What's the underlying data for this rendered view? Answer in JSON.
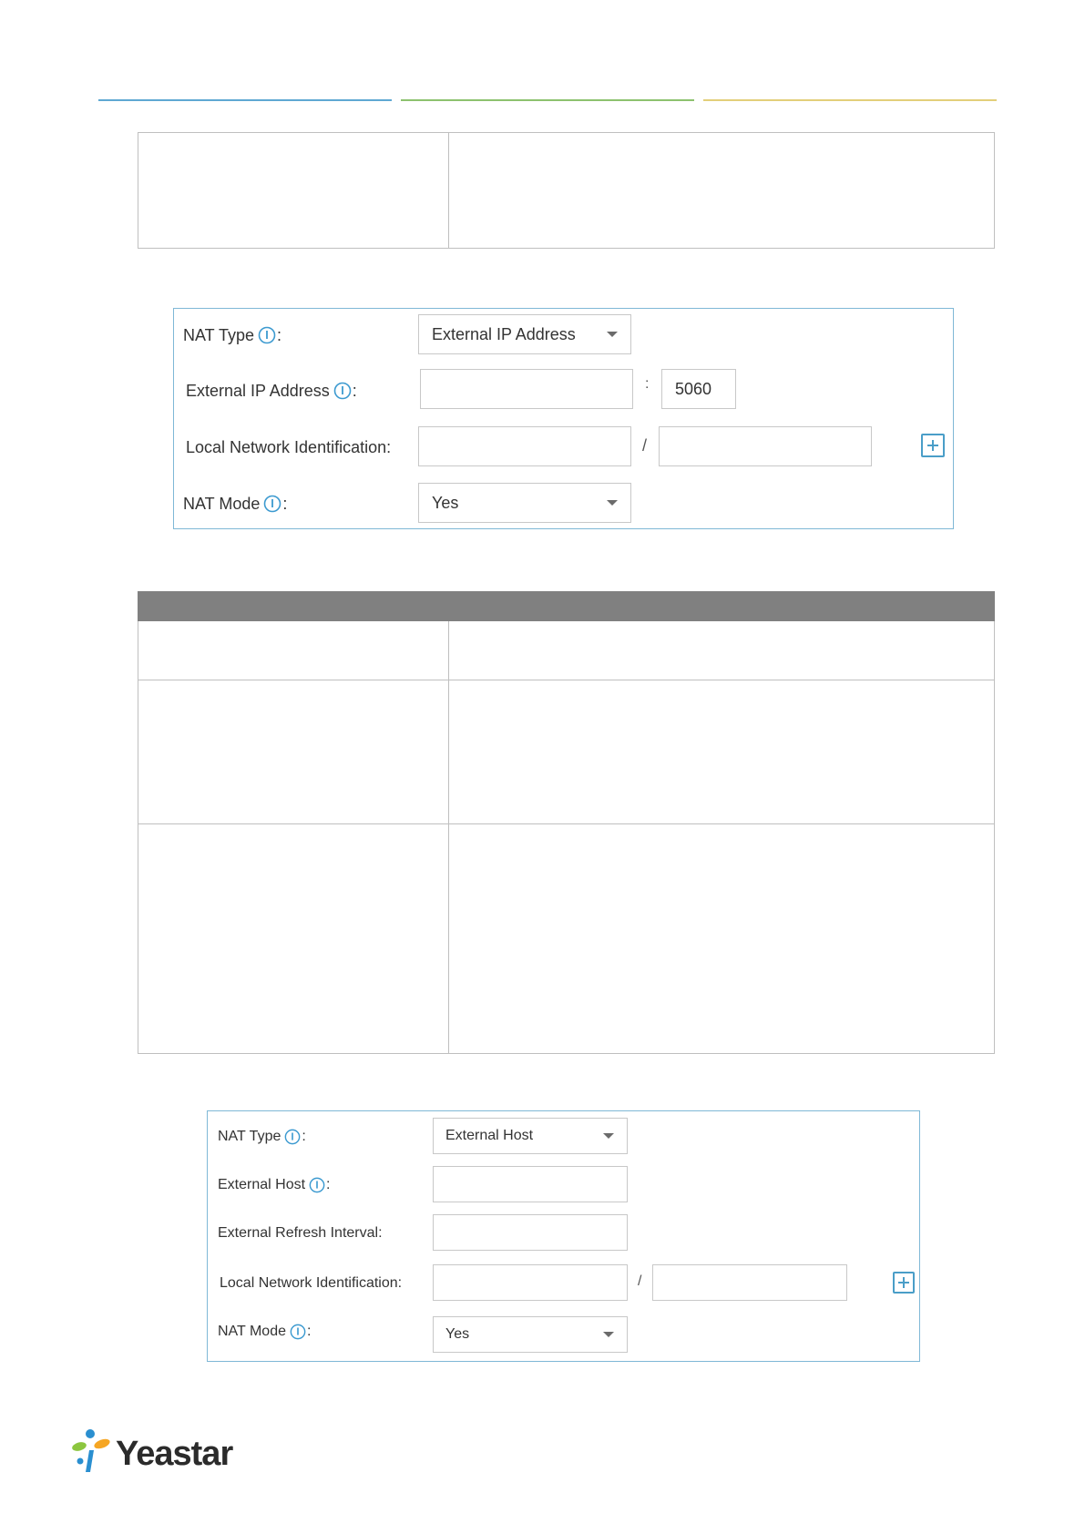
{
  "header": {
    "rule_colors": [
      "#5fa8d3",
      "#8dc26f",
      "#e3cf7a"
    ]
  },
  "table1": {
    "rows": [
      [
        "",
        ""
      ]
    ]
  },
  "panel1": {
    "nat_type": {
      "label": "NAT Type",
      "value": "External IP Address"
    },
    "external_ip": {
      "label": "External IP Address",
      "value": "",
      "port_separator": ":",
      "port": "5060"
    },
    "local_network": {
      "label": "Local Network Identification:",
      "ip_value": "",
      "separator": "/",
      "mask_value": ""
    },
    "nat_mode": {
      "label": "NAT Mode",
      "value": "Yes"
    }
  },
  "table2": {
    "header": [
      "",
      ""
    ],
    "rows": [
      [
        "",
        ""
      ],
      [
        "",
        ""
      ],
      [
        "",
        ""
      ]
    ]
  },
  "panel2": {
    "nat_type": {
      "label": "NAT Type",
      "value": "External Host"
    },
    "external_host": {
      "label": "External Host",
      "value": ""
    },
    "refresh_interval": {
      "label": "External Refresh Interval:",
      "value": ""
    },
    "local_network": {
      "label": "Local Network Identification:",
      "ip_value": "",
      "separator": "/",
      "mask_value": ""
    },
    "nat_mode": {
      "label": "NAT Mode",
      "value": "Yes"
    }
  },
  "footer": {
    "logo_text": "Yeastar"
  },
  "colors": {
    "panel_border": "#7fb8d6",
    "info_icon": "#3c9ad0",
    "table_header_bg": "#808080"
  },
  "icons": [
    "info-icon",
    "chevron-down-icon",
    "plus-icon",
    "yeastar-logo-icon"
  ]
}
